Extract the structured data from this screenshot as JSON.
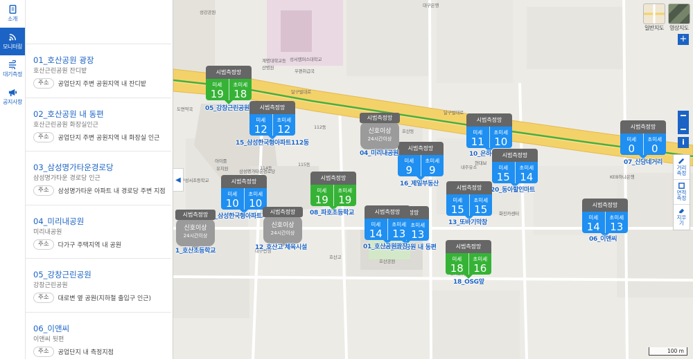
{
  "nav": [
    {
      "label": "소개",
      "icon": "document-icon",
      "active": false
    },
    {
      "label": "모니터링",
      "icon": "wifi-icon",
      "active": true
    },
    {
      "label": "대기측정",
      "icon": "air-icon",
      "active": false
    },
    {
      "label": "공지사항",
      "icon": "megaphone-icon",
      "active": false
    }
  ],
  "address_badge": "주소",
  "stations": [
    {
      "title": "01_호산공원 광장",
      "location": "호산근린공원 잔디밭",
      "address": "공업단지 주변 공원지역 내 잔디밭"
    },
    {
      "title": "02_호산공원 내 동편",
      "location": "호산근린공원 화장실인근",
      "address": "공업단지 주변 공원지역 내 화장실 인근"
    },
    {
      "title": "03_삼성명가타운경로당",
      "location": "삼성명가타운 경로당 인근",
      "address": "삼성명가타운 아파트 내 경로당 주변 지점"
    },
    {
      "title": "04_미리내공원",
      "location": "미리내공원",
      "address": "다가구 주택지역 내 공원"
    },
    {
      "title": "05_강창근린공원",
      "location": "강창근린공원",
      "address": "대로변 옆 공원(지하철 출입구 인근)"
    },
    {
      "title": "06_이앤씨",
      "location": "이앤씨 뒷편",
      "address": "공업단지 내 측정지점"
    }
  ],
  "marker_header": "시범측정망",
  "pm10_label": "미세",
  "pm25_label": "초미세",
  "markers": [
    {
      "name": "05_강창근린공원",
      "pm10": "19",
      "pm25": "18",
      "color": "green"
    },
    {
      "name": "15_삼성한국형아파트112동",
      "pm10": "12",
      "pm25": "12",
      "color": "blue"
    },
    {
      "name": "10_은하수공원",
      "pm10": "11",
      "pm25": "10",
      "color": "blue"
    },
    {
      "name": "07_신당네거리",
      "pm10": "0",
      "pm25": "0",
      "color": "blue"
    },
    {
      "name": "16_제일부동산",
      "pm10": "9",
      "pm25": "9",
      "color": "blue"
    },
    {
      "name": "20_동아할인마트",
      "pm10": "15",
      "pm25": "14",
      "color": "blue"
    },
    {
      "name": "08_파호초등학교",
      "pm10": "19",
      "pm25": "19",
      "color": "green"
    },
    {
      "name": "13_또바기막창",
      "pm10": "15",
      "pm25": "15",
      "color": "blue"
    },
    {
      "name": "09_삼성한국형아파트지곤",
      "pm10": "10",
      "pm25": "10",
      "color": "blue"
    },
    {
      "name": "01_호산공원광장",
      "pm10": "14",
      "pm25": "13",
      "color": "blue"
    },
    {
      "name": "02_호산공원 내 동편",
      "pm10": "14",
      "pm25": "13",
      "color": "blue"
    },
    {
      "name": "06_이앤씨",
      "pm10": "14",
      "pm25": "13",
      "color": "blue"
    },
    {
      "name": "18_OSG앞",
      "pm10": "18",
      "pm25": "16",
      "color": "green"
    }
  ],
  "offline_markers": [
    {
      "name": "04_미리내공원",
      "status": "신호이상",
      "duration": "24시간이상"
    },
    {
      "name": "1_호산초등학교",
      "status": "신호이상",
      "duration": "24시간이상"
    },
    {
      "name": "12_호산고 체육시설",
      "status": "신호이상",
      "duration": "24시간이상"
    }
  ],
  "map_labels": [
    "성강공원",
    "대구은행",
    "계명대학교동산병원",
    "성서캠퍼스대학교",
    "우편취급국",
    "도면약국",
    "대구성서초등학교",
    "아이를",
    "유치원",
    "삼성명가타운경로당",
    "호산고",
    "호산공원",
    "화진카센터",
    "KEB하나은행",
    "BM모터스",
    "달구벌대로",
    "달구벌대로",
    "114동",
    "112동",
    "115동",
    "호산동",
    "대구선생",
    "현대보",
    "내주유소"
  ],
  "map_types": [
    {
      "label": "일반지도"
    },
    {
      "label": "영상지도"
    }
  ],
  "zoom_plus": "+",
  "info_label": "i",
  "tools": [
    {
      "label": "거리\n측정"
    },
    {
      "label": "면적\n측정"
    },
    {
      "label": "지우\n기"
    }
  ],
  "scale": "100 m",
  "collapse_arrow": "◀"
}
